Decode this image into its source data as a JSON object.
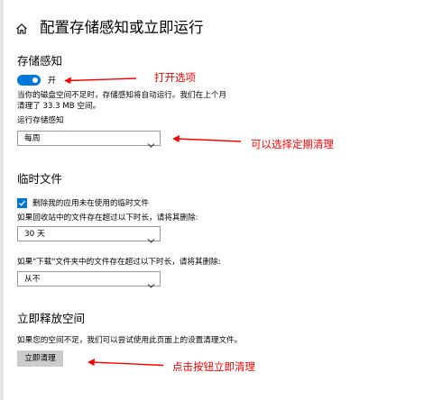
{
  "header": {
    "home_icon": "home-icon",
    "title": "配置存储感知或立即运行"
  },
  "storage_sense": {
    "title": "存储感知",
    "toggle_state": "开",
    "toggle_on": true,
    "description": "当你的磁盘空间不足时，存储感知将自动运行。我们在上个月清理了 33.3 MB 空间。",
    "run_label": "运行存储感知",
    "run_value": "每周"
  },
  "temp_files": {
    "title": "临时文件",
    "checkbox_label": "删除我的应用未在使用的临时文件",
    "checkbox_checked": true,
    "recycle_label": "如果回收站中的文件存在超过以下时长，请将其删除:",
    "recycle_value": "30 天",
    "downloads_label": "如果\"下载\"文件夹中的文件存在超过以下时长，请将其删除:",
    "downloads_value": "从不"
  },
  "free_space": {
    "title": "立即释放空间",
    "description": "如果您的空间不足，我们可以尝试使用此页面上的设置清理文件。",
    "button_label": "立即清理"
  },
  "annotations": {
    "toggle_note": "打开选项",
    "schedule_note": "可以选择定期清理",
    "button_note": "点击按钮立即清理"
  },
  "colors": {
    "accent": "#0078d7",
    "annotation": "#ff0000",
    "button_bg": "#cccccc"
  }
}
